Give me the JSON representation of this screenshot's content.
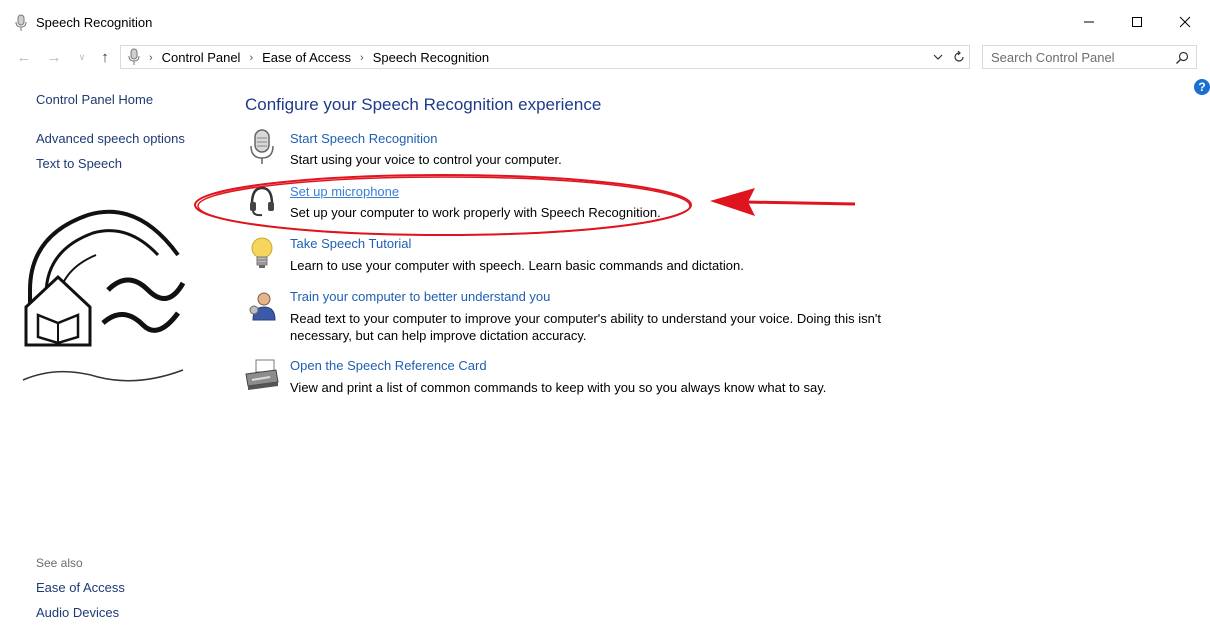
{
  "window": {
    "title": "Speech Recognition",
    "title_icon": "microphone-icon",
    "controls": [
      "minimize-icon",
      "maximize-icon",
      "close-icon"
    ]
  },
  "address_bar": {
    "location_icon": "microphone-icon",
    "breadcrumbs": [
      "Control Panel",
      "Ease of Access",
      "Speech Recognition"
    ],
    "search_placeholder": "Search Control Panel"
  },
  "left_pane": {
    "home_link": "Control Panel Home",
    "links": [
      "Advanced speech options",
      "Text to Speech"
    ],
    "see_also_heading": "See also",
    "see_also_links": [
      "Ease of Access",
      "Audio Devices"
    ]
  },
  "main": {
    "title": "Configure your Speech Recognition experience",
    "tasks": [
      {
        "link": "Start Speech Recognition",
        "description": "Start using your voice to control your computer.",
        "icon": "microphone-icon"
      },
      {
        "link": "Set up microphone",
        "description": "Set up your computer to work properly with Speech Recognition.",
        "icon": "headset-icon"
      },
      {
        "link": "Take Speech Tutorial",
        "description": "Learn to use your computer with speech.  Learn basic commands and dictation.",
        "icon": "lightbulb-icon"
      },
      {
        "link": "Train your computer to better understand you",
        "description": "Read text to your computer to improve your computer's ability to understand your voice.  Doing this isn't necessary, but can help improve dictation accuracy.",
        "icon": "user-icon"
      },
      {
        "link": "Open the Speech Reference Card",
        "description": "View and print a list of common commands to keep with you so you always know what to say.",
        "icon": "printer-icon"
      }
    ]
  },
  "colors": {
    "link": "#1f5fb3",
    "heading": "#1e3a8a",
    "annotation_red": "#e0141e",
    "help_blue": "#1a6fd0"
  }
}
